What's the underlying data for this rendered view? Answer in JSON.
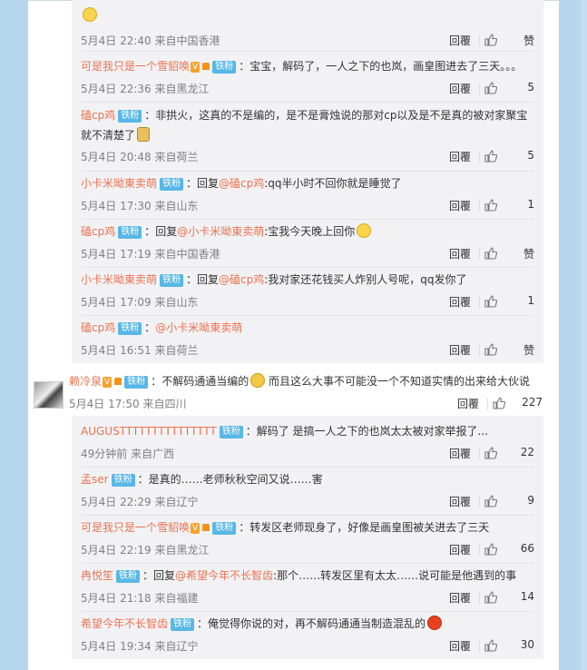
{
  "top_partial": {
    "text": "……"
  },
  "box1": [
    {
      "id": "r1",
      "body": [
        {
          "type": "emoji",
          "name": "cry-emoji"
        }
      ],
      "time": "5月4日 22:40 来自中国香港",
      "reply": "回覆",
      "like": "赞"
    },
    {
      "id": "r2",
      "name": "可是我只是一个雪貂唤",
      "vip": "V",
      "badge": "铁粉",
      "body": [
        {
          "type": "text",
          "v": "：宝宝，解码了，一人之下的也岚，画皇图进去了三天。。。"
        }
      ],
      "time": "5月4日 22:36 来自黑龙江",
      "reply": "回覆",
      "like": "5"
    },
    {
      "id": "r3",
      "name": "磕cp鸡",
      "badge": "铁粉",
      "body": [
        {
          "type": "text",
          "v": "：非拱火，这真的不是编的，是不是膏烛说的那对cp以及是不是真的被对家聚宝就不清楚了"
        },
        {
          "type": "emoji",
          "name": "doge-emoji"
        }
      ],
      "wrap": true,
      "time": "5月4日 20:48 来自荷兰",
      "reply": "回覆",
      "like": "5"
    },
    {
      "id": "r4",
      "name": "小卡米呦東卖萌",
      "badge": "铁粉",
      "body": [
        {
          "type": "text",
          "v": "：回复"
        },
        {
          "type": "link",
          "v": "@磕cp鸡"
        },
        {
          "type": "text",
          "v": ":qq半小时不回你就是睡觉了"
        }
      ],
      "time": "5月4日 17:30 来自山东",
      "reply": "回覆",
      "like": "1"
    },
    {
      "id": "r5",
      "name": "磕cp鸡",
      "badge": "铁粉",
      "body": [
        {
          "type": "text",
          "v": "：回复"
        },
        {
          "type": "link",
          "v": "@小卡米呦東卖萌"
        },
        {
          "type": "text",
          "v": ":宝我今天晚上回你"
        },
        {
          "type": "emoji",
          "name": "cry-emoji"
        }
      ],
      "time": "5月4日 17:19 来自中国香港",
      "reply": "回覆",
      "like": "赞"
    },
    {
      "id": "r6",
      "name": "小卡米呦東卖萌",
      "badge": "铁粉",
      "body": [
        {
          "type": "text",
          "v": "：回复"
        },
        {
          "type": "link",
          "v": "@磕cp鸡"
        },
        {
          "type": "text",
          "v": ":我对家还花钱买人炸别人号呢，qq发你了"
        }
      ],
      "time": "5月4日 17:09 来自山东",
      "reply": "回覆",
      "like": "1"
    },
    {
      "id": "r7",
      "name": "磕cp鸡",
      "badge": "铁粉",
      "body": [
        {
          "type": "text",
          "v": "："
        },
        {
          "type": "link",
          "v": "@小卡米呦東卖萌"
        }
      ],
      "time": "5月4日 16:51 来自荷兰",
      "reply": "回覆",
      "like": "赞"
    }
  ],
  "main": {
    "name": "赖冷泉",
    "vip": "V",
    "badge": "铁粉",
    "body": [
      {
        "type": "text",
        "v": "：不解码通通当编的"
      },
      {
        "type": "emoji",
        "name": "laugh-emoji"
      },
      {
        "type": "text",
        "v": " 而且这么大事不可能没一个不知道实情的出来给大伙说"
      }
    ],
    "time": "5月4日 17:50 来自四川",
    "reply": "回覆",
    "like": "227"
  },
  "box2": [
    {
      "id": "s1",
      "name": "AUGUSTTTTTTTTTTTTTTT",
      "badge": "铁粉",
      "body": [
        {
          "type": "text",
          "v": "：解码了 是搞一人之下的也岚太太被对家举报了..."
        }
      ],
      "time": "49分钟前 来自广西",
      "reply": "回覆",
      "like": "22"
    },
    {
      "id": "s2",
      "name": "孟ser",
      "badge": "铁粉",
      "body": [
        {
          "type": "text",
          "v": "：是真的……老师秋秋空间又说……害"
        }
      ],
      "time": "5月4日 22:29 来自辽宁",
      "reply": "回覆",
      "like": "9"
    },
    {
      "id": "s3",
      "name": "可是我只是一个雪貂唤",
      "vip": "V",
      "badge": "铁粉",
      "body": [
        {
          "type": "text",
          "v": "：转发区老师现身了，好像是画皇图被关进去了三天"
        }
      ],
      "time": "5月4日 22:19 来自黑龙江",
      "reply": "回覆",
      "like": "66"
    },
    {
      "id": "s4",
      "name": "冉悦笙",
      "badge": "铁粉",
      "body": [
        {
          "type": "text",
          "v": "：回复"
        },
        {
          "type": "link",
          "v": "@希望今年不长智齿"
        },
        {
          "type": "text",
          "v": ":那个……转发区里有太太……说可能是他遇到的事"
        }
      ],
      "time": "5月4日 21:18 来自福建",
      "reply": "回覆",
      "like": "14"
    },
    {
      "id": "s5",
      "name": "希望今年不长智齿",
      "badge": "铁粉",
      "body": [
        {
          "type": "text",
          "v": "：俺觉得你说的对，再不解码通通当制造混乱的"
        },
        {
          "type": "emoji",
          "name": "angry-emoji"
        }
      ],
      "time": "5月4日 19:34 来自辽宁",
      "reply": "回覆",
      "like": "30"
    }
  ]
}
